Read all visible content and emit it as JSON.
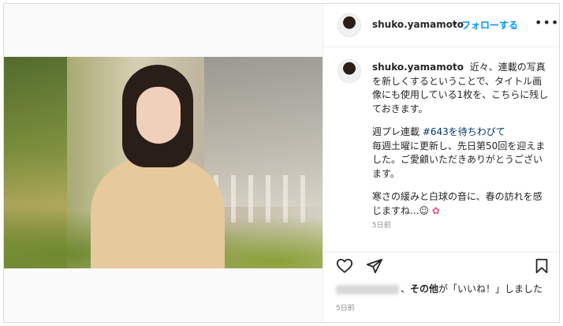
{
  "post": {
    "author": "shuko.yamamoto",
    "separator": "•",
    "follow_label": "フォローする",
    "more_label": "•••",
    "caption_lines": [
      "近々、連載の写真を新しくするということで、タイトル画像にも使用している1枚を、こちらに残しておきます。"
    ],
    "para2_prefix": "週プレ連載 ",
    "hashtag": "#643を待ちわびて",
    "para2_rest": "毎週土曜に更新し、先日第50回を迎えました。ご愛顧いただきありがとうございます。",
    "para3": "寒さの緩みと白球の音に、春の訪れを感じますね...☺",
    "flower_icon": "✿",
    "time_ago": "5日前",
    "likes_text_bold": "その他",
    "likes_text_1": "、",
    "likes_text_2": "が「いいね！」しました",
    "date": "5日前"
  },
  "icons": {
    "like": "heart-outline-icon",
    "share": "paper-plane-icon",
    "save": "bookmark-icon",
    "more": "more-horizontal-icon"
  },
  "colors": {
    "follow": "#0095f6",
    "hashtag": "#00376b",
    "muted": "#8e8e8e",
    "text": "#262626"
  }
}
